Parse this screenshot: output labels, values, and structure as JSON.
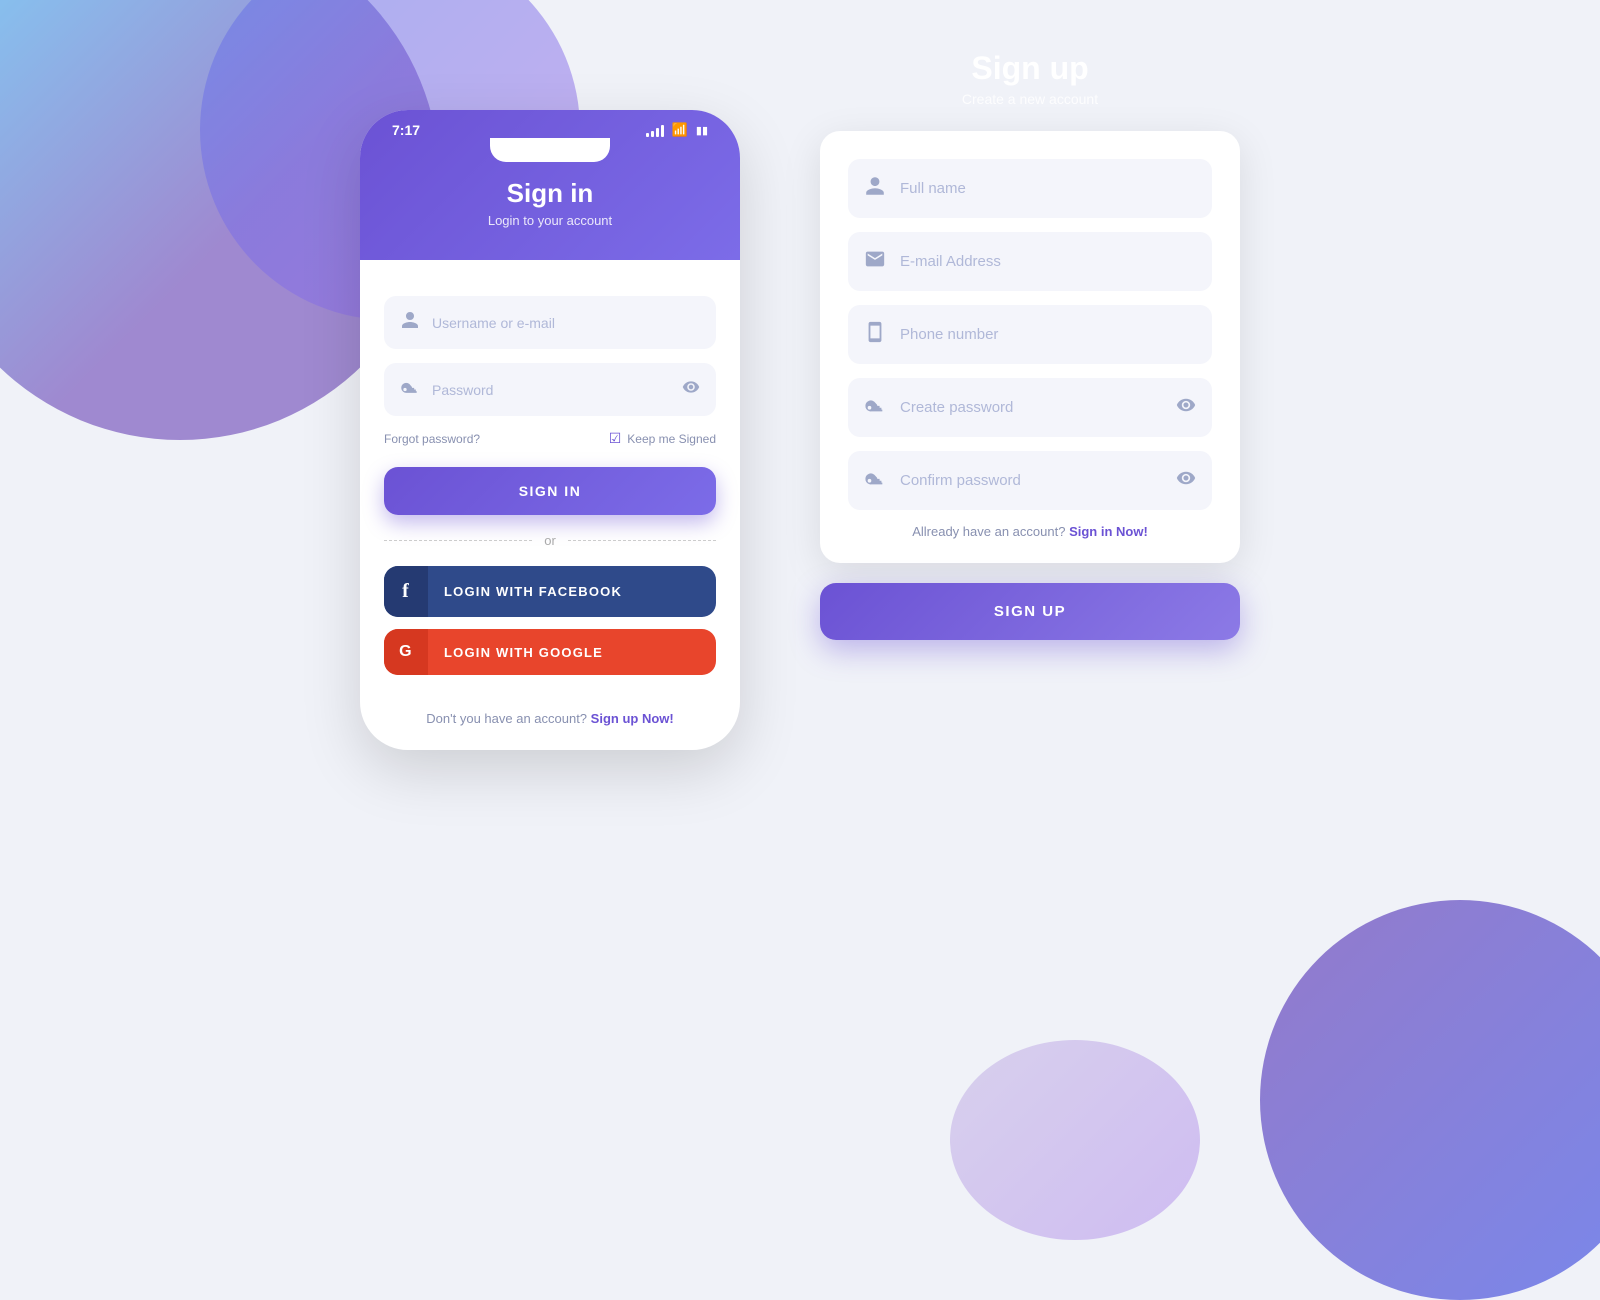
{
  "background": {
    "color": "#f0f2f8"
  },
  "signin": {
    "status_time": "7:17",
    "title": "Sign in",
    "subtitle": "Login to your account",
    "username_placeholder": "Username or e-mail",
    "password_placeholder": "Password",
    "forgot_label": "Forgot password?",
    "keep_signed_label": "Keep me Signed",
    "signin_button": "SIGN IN",
    "divider_text": "or",
    "facebook_button": "LOGIN WITH FACEBOOK",
    "google_button": "LOGIN WITH GOOGLE",
    "footer_text": "Don't you have an account?",
    "footer_link": "Sign up Now!"
  },
  "signup": {
    "title": "Sign up",
    "subtitle": "Create a new account",
    "fullname_placeholder": "Full name",
    "email_placeholder": "E-mail Address",
    "phone_placeholder": "Phone number",
    "create_password_placeholder": "Create password",
    "confirm_password_placeholder": "Confirm password",
    "already_text": "Allready have an account?",
    "already_link": "Sign in Now!",
    "signup_button": "SIGN UP"
  }
}
